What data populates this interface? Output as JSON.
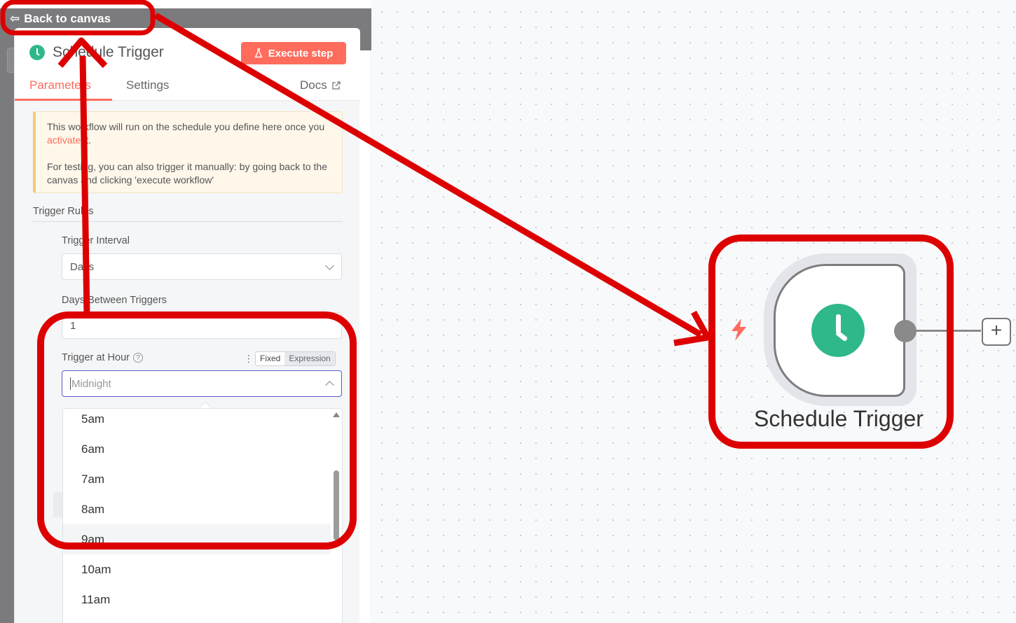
{
  "header": {
    "back_label": "Back to canvas"
  },
  "panel": {
    "title": "Schedule Trigger",
    "execute_label": "Execute step",
    "tabs": [
      "Parameters",
      "Settings"
    ],
    "docs_label": "Docs",
    "notice": {
      "line1_pre": "This workflow will run on the schedule you define here once you ",
      "line1_link": "activate",
      "line1_post": " it.",
      "line2": "For testing, you can also trigger it manually: by going back to the canvas and clicking 'execute workflow'"
    },
    "trigger_rules_label": "Trigger Rules",
    "trigger_interval": {
      "label": "Trigger Interval",
      "value": "Days"
    },
    "days_between": {
      "label": "Days Between Triggers",
      "value": "1"
    },
    "trigger_hour": {
      "label": "Trigger at Hour",
      "help": "?",
      "mode_fixed": "Fixed",
      "mode_expression": "Expression",
      "placeholder": "Midnight"
    },
    "hour_options": [
      "5am",
      "6am",
      "7am",
      "8am",
      "9am",
      "10am",
      "11am"
    ],
    "hovered_option": "9am"
  },
  "canvas": {
    "node_label": "Schedule Trigger",
    "add_symbol": "+"
  },
  "colors": {
    "accent": "#ff6c5c",
    "node_green": "#2fb88a",
    "annotation_red": "#dd0000"
  },
  "icons": [
    "back-arrow-icon",
    "clock-icon",
    "flask-icon",
    "external-link-icon",
    "help-icon",
    "chevron-down-icon",
    "chevron-up-icon",
    "bolt-icon",
    "plus-icon"
  ]
}
